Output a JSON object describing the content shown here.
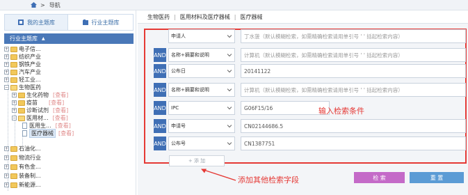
{
  "topnav": {
    "crumb": "导航",
    "home_icon": "home-icon"
  },
  "left_panel": {
    "tabs": [
      {
        "label": "我的主题库",
        "icon": "library-icon"
      },
      {
        "label": "行业主题库",
        "icon": "industry-icon"
      }
    ],
    "header": "行业主题库",
    "view_label": "[查看]",
    "tree": [
      {
        "label": "电子信..."
      },
      {
        "label": "纺织产业"
      },
      {
        "label": "钢铁产业"
      },
      {
        "label": "汽车产业"
      },
      {
        "label": "轻工业..."
      },
      {
        "label": "生物医药"
      },
      {
        "label": "生化药物"
      },
      {
        "label": "疫苗"
      },
      {
        "label": "诊断试剂"
      },
      {
        "label": "医用材..."
      },
      {
        "label": "医用生..."
      },
      {
        "label": "医疗器械"
      },
      {
        "label": "石油化..."
      },
      {
        "label": "物流行业"
      },
      {
        "label": "有色金..."
      },
      {
        "label": "装备制..."
      },
      {
        "label": "新能源..."
      }
    ]
  },
  "breadcrumb": [
    "生物医药",
    "医用材料及医疗器械",
    "医疗器械"
  ],
  "search_rows": [
    {
      "op": "",
      "field": "申请人",
      "value": "",
      "placeholder": "丁水菠（默认模糊检索，如需精确检索请用单引号 ' ' 括起检索内容）"
    },
    {
      "op": "AND",
      "field": "名称+摘要和说明",
      "value": "",
      "placeholder": "计算机（默认模糊检索，如需精确检索请用单引号 ' ' 括起检索内容）"
    },
    {
      "op": "AND",
      "field": "公布日",
      "value": "20141122",
      "placeholder": ""
    },
    {
      "op": "AND",
      "field": "名称+摘要和说明",
      "value": "",
      "placeholder": "计算机（默认模糊检索，如需精确检索请用单引号 ' ' 括起检索内容）"
    },
    {
      "op": "AND",
      "field": "IPC",
      "value": "G06F15/16",
      "placeholder": ""
    },
    {
      "op": "AND",
      "field": "申请号",
      "value": "CN02144686.5",
      "placeholder": ""
    },
    {
      "op": "AND",
      "field": "公布号",
      "value": "CN1387751",
      "placeholder": ""
    }
  ],
  "annotation_input": "输入检索条件",
  "add_field_label": "+ 添  加",
  "annotation_add": "添加其他检索字段",
  "buttons": {
    "search": "检  索",
    "reset": "重  置"
  },
  "colors": {
    "accent": "#3f6fb5",
    "highlight": "#e53935",
    "search_btn": "#c46ac8",
    "reset_btn": "#5b9bd5"
  }
}
